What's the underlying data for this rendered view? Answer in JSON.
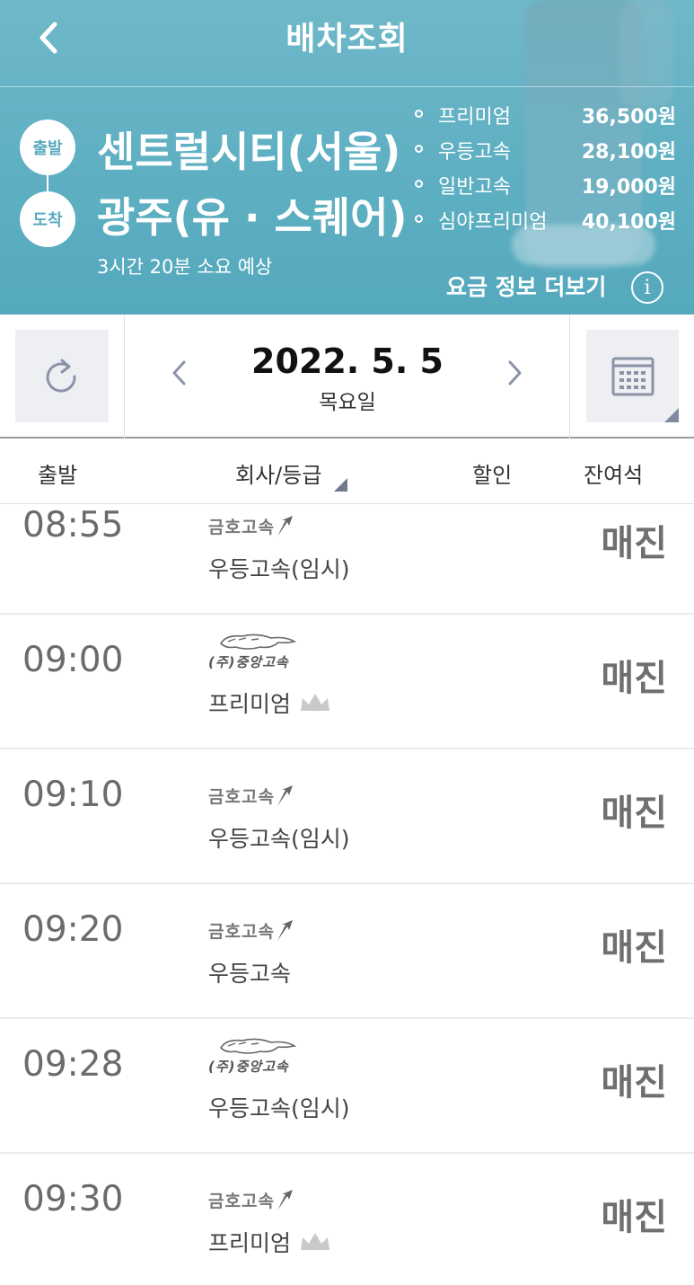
{
  "header": {
    "title": "배차조회",
    "departure_badge": "출발",
    "arrival_badge": "도착",
    "departure": "센트럴시티(서울)",
    "arrival": "광주(유 · 스퀘어)",
    "duration": "3시간 20분 소요 예상",
    "fares": [
      {
        "name": "프리미엄",
        "price": "36,500원"
      },
      {
        "name": "우등고속",
        "price": "28,100원"
      },
      {
        "name": "일반고속",
        "price": "19,000원"
      },
      {
        "name": "심야프리미엄",
        "price": "40,100원"
      }
    ],
    "more_fare": "요금 정보 더보기",
    "info_icon_text": "i"
  },
  "datebar": {
    "date": "2022. 5. 5",
    "weekday": "목요일"
  },
  "table": {
    "headers": [
      "출발",
      "회사/등급",
      "할인",
      "잔여석"
    ],
    "rows": [
      {
        "time": "08:55",
        "company": "금호고속",
        "grade": "우등고속(임시)",
        "premium": false,
        "status": "매진"
      },
      {
        "time": "09:00",
        "company": "(주)중앙고속",
        "grade": "프리미엄",
        "premium": true,
        "status": "매진"
      },
      {
        "time": "09:10",
        "company": "금호고속",
        "grade": "우등고속(임시)",
        "premium": false,
        "status": "매진"
      },
      {
        "time": "09:20",
        "company": "금호고속",
        "grade": "우등고속",
        "premium": false,
        "status": "매진"
      },
      {
        "time": "09:28",
        "company": "(주)중앙고속",
        "grade": "우등고속(임시)",
        "premium": false,
        "status": "매진"
      },
      {
        "time": "09:30",
        "company": "금호고속",
        "grade": "프리미엄",
        "premium": true,
        "status": "매진"
      }
    ]
  },
  "colors": {
    "header_bg": "#5eafc2",
    "sold_out": "#6f6f6f",
    "button_bg": "#eeeff3"
  }
}
